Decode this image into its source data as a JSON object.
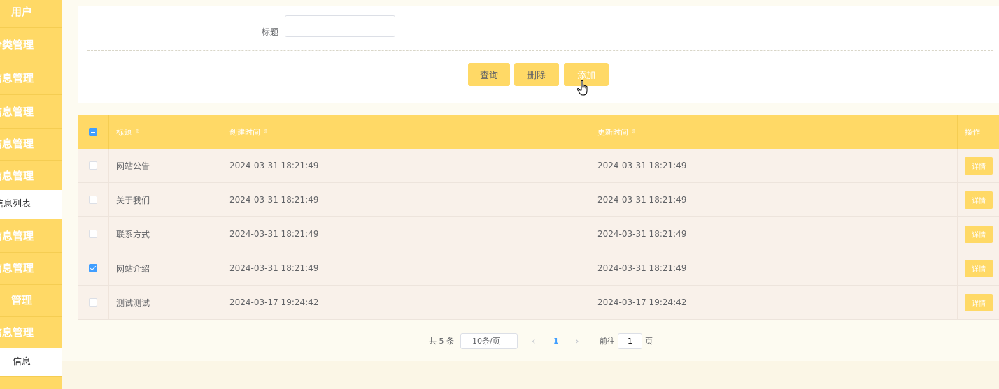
{
  "sidebar": {
    "items": [
      {
        "label": "用户",
        "sub": false
      },
      {
        "label": "分类管理",
        "sub": false
      },
      {
        "label": "信息管理",
        "sub": false
      },
      {
        "label": "信息管理",
        "sub": false
      },
      {
        "label": "信息管理",
        "sub": false
      },
      {
        "label": "信息管理",
        "sub": false
      },
      {
        "label": "信息列表",
        "sub": true
      },
      {
        "label": "信息管理",
        "sub": false
      },
      {
        "label": "信息管理",
        "sub": false
      },
      {
        "label": "管理",
        "sub": false
      },
      {
        "label": "信息管理",
        "sub": false
      },
      {
        "label": "信息",
        "sub": true
      }
    ]
  },
  "search": {
    "title_label": "标题",
    "title_value": "",
    "query_label": "查询",
    "delete_label": "删除",
    "add_label": "添加"
  },
  "table": {
    "headers": {
      "title": "标题",
      "created": "创建时间",
      "updated": "更新时间",
      "action": "操作",
      "sort_glyph": "⇕"
    },
    "header_select_state": "indeterminate",
    "rows": [
      {
        "checked": false,
        "title": "网站公告",
        "created": "2024-03-31 18:21:49",
        "updated": "2024-03-31 18:21:49",
        "action": "详情"
      },
      {
        "checked": false,
        "title": "关于我们",
        "created": "2024-03-31 18:21:49",
        "updated": "2024-03-31 18:21:49",
        "action": "详情"
      },
      {
        "checked": false,
        "title": "联系方式",
        "created": "2024-03-31 18:21:49",
        "updated": "2024-03-31 18:21:49",
        "action": "详情"
      },
      {
        "checked": true,
        "title": "网站介绍",
        "created": "2024-03-31 18:21:49",
        "updated": "2024-03-31 18:21:49",
        "action": "详情"
      },
      {
        "checked": false,
        "title": "测试测试",
        "created": "2024-03-17 19:24:42",
        "updated": "2024-03-17 19:24:42",
        "action": "详情"
      }
    ]
  },
  "pagination": {
    "total": "共 5 条",
    "page_size": "10条/页",
    "prev": "‹",
    "current": "1",
    "next": "›",
    "goto_label": "前往",
    "goto_value": "1",
    "page_suffix": "页"
  },
  "colors": {
    "theme": "#ffd966",
    "row_bg": "#f9f1ea",
    "checkbox_active": "#409eff",
    "page_active": "#409eff"
  }
}
